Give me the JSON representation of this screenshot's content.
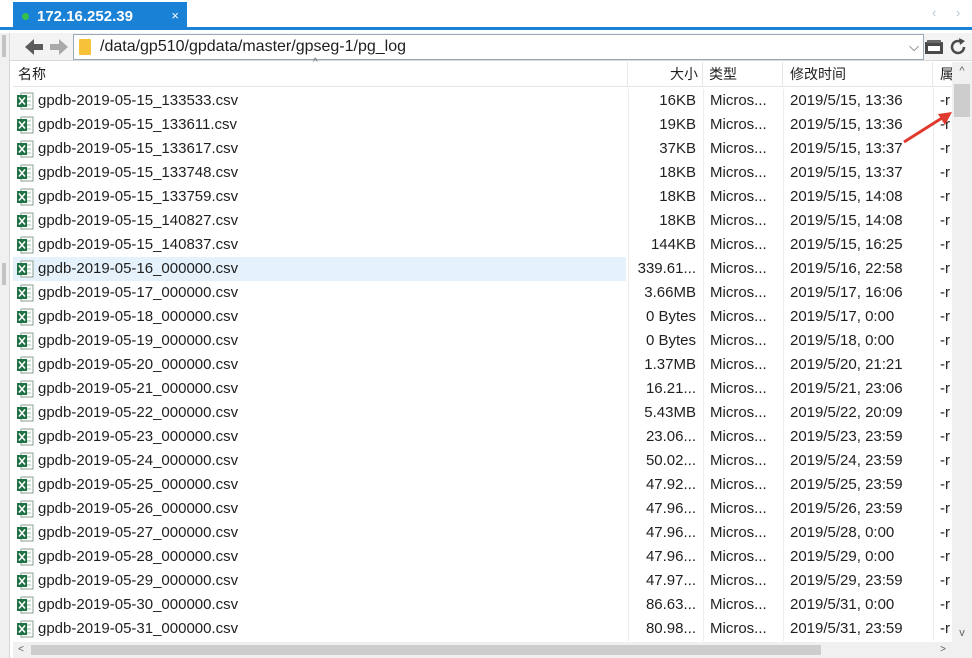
{
  "tab": {
    "title": "172.16.252.39",
    "close_glyph": "×",
    "prev_glyph": "‹",
    "next_glyph": "›"
  },
  "address": {
    "path": "/data/gp510/gpdata/master/gpseg-1/pg_log",
    "dropdown_glyph": "⌵"
  },
  "icons": {
    "back": "back-arrow-icon",
    "forward": "forward-arrow-icon",
    "folder": "folder-icon",
    "drive": "drive-icon",
    "refresh": "refresh-icon",
    "file": "excel-file-icon"
  },
  "columns": {
    "name": "名称",
    "size": "大小",
    "type": "类型",
    "modified": "修改时间",
    "attr": "属"
  },
  "scroll": {
    "up_glyph": "^",
    "down_glyph": "v",
    "left_glyph": "<",
    "right_glyph": ">"
  },
  "colors": {
    "accent": "#1a82d6",
    "connected_dot": "#35c24a",
    "selected_row": "#e5f1fb",
    "arrow": "#e03a2e",
    "excel_green": "#1e7145"
  },
  "files": [
    {
      "name": "gpdb-2019-05-15_133533.csv",
      "size": "16KB",
      "type": "Micros...",
      "modified": "2019/5/15, 13:36",
      "attr": "-r"
    },
    {
      "name": "gpdb-2019-05-15_133611.csv",
      "size": "19KB",
      "type": "Micros...",
      "modified": "2019/5/15, 13:36",
      "attr": "-r"
    },
    {
      "name": "gpdb-2019-05-15_133617.csv",
      "size": "37KB",
      "type": "Micros...",
      "modified": "2019/5/15, 13:37",
      "attr": "-r"
    },
    {
      "name": "gpdb-2019-05-15_133748.csv",
      "size": "18KB",
      "type": "Micros...",
      "modified": "2019/5/15, 13:37",
      "attr": "-r"
    },
    {
      "name": "gpdb-2019-05-15_133759.csv",
      "size": "18KB",
      "type": "Micros...",
      "modified": "2019/5/15, 14:08",
      "attr": "-r"
    },
    {
      "name": "gpdb-2019-05-15_140827.csv",
      "size": "18KB",
      "type": "Micros...",
      "modified": "2019/5/15, 14:08",
      "attr": "-r"
    },
    {
      "name": "gpdb-2019-05-15_140837.csv",
      "size": "144KB",
      "type": "Micros...",
      "modified": "2019/5/15, 16:25",
      "attr": "-r"
    },
    {
      "name": "gpdb-2019-05-16_000000.csv",
      "size": "339.61...",
      "type": "Micros...",
      "modified": "2019/5/16, 22:58",
      "attr": "-r",
      "selected": true
    },
    {
      "name": "gpdb-2019-05-17_000000.csv",
      "size": "3.66MB",
      "type": "Micros...",
      "modified": "2019/5/17, 16:06",
      "attr": "-r"
    },
    {
      "name": "gpdb-2019-05-18_000000.csv",
      "size": "0 Bytes",
      "type": "Micros...",
      "modified": "2019/5/17, 0:00",
      "attr": "-r"
    },
    {
      "name": "gpdb-2019-05-19_000000.csv",
      "size": "0 Bytes",
      "type": "Micros...",
      "modified": "2019/5/18, 0:00",
      "attr": "-r"
    },
    {
      "name": "gpdb-2019-05-20_000000.csv",
      "size": "1.37MB",
      "type": "Micros...",
      "modified": "2019/5/20, 21:21",
      "attr": "-r"
    },
    {
      "name": "gpdb-2019-05-21_000000.csv",
      "size": "16.21...",
      "type": "Micros...",
      "modified": "2019/5/21, 23:06",
      "attr": "-r"
    },
    {
      "name": "gpdb-2019-05-22_000000.csv",
      "size": "5.43MB",
      "type": "Micros...",
      "modified": "2019/5/22, 20:09",
      "attr": "-r"
    },
    {
      "name": "gpdb-2019-05-23_000000.csv",
      "size": "23.06...",
      "type": "Micros...",
      "modified": "2019/5/23, 23:59",
      "attr": "-r"
    },
    {
      "name": "gpdb-2019-05-24_000000.csv",
      "size": "50.02...",
      "type": "Micros...",
      "modified": "2019/5/24, 23:59",
      "attr": "-r"
    },
    {
      "name": "gpdb-2019-05-25_000000.csv",
      "size": "47.92...",
      "type": "Micros...",
      "modified": "2019/5/25, 23:59",
      "attr": "-r"
    },
    {
      "name": "gpdb-2019-05-26_000000.csv",
      "size": "47.96...",
      "type": "Micros...",
      "modified": "2019/5/26, 23:59",
      "attr": "-r"
    },
    {
      "name": "gpdb-2019-05-27_000000.csv",
      "size": "47.96...",
      "type": "Micros...",
      "modified": "2019/5/28, 0:00",
      "attr": "-r"
    },
    {
      "name": "gpdb-2019-05-28_000000.csv",
      "size": "47.96...",
      "type": "Micros...",
      "modified": "2019/5/29, 0:00",
      "attr": "-r"
    },
    {
      "name": "gpdb-2019-05-29_000000.csv",
      "size": "47.97...",
      "type": "Micros...",
      "modified": "2019/5/29, 23:59",
      "attr": "-r"
    },
    {
      "name": "gpdb-2019-05-30_000000.csv",
      "size": "86.63...",
      "type": "Micros...",
      "modified": "2019/5/31, 0:00",
      "attr": "-r"
    },
    {
      "name": "gpdb-2019-05-31_000000.csv",
      "size": "80.98...",
      "type": "Micros...",
      "modified": "2019/5/31, 23:59",
      "attr": "-r"
    }
  ]
}
